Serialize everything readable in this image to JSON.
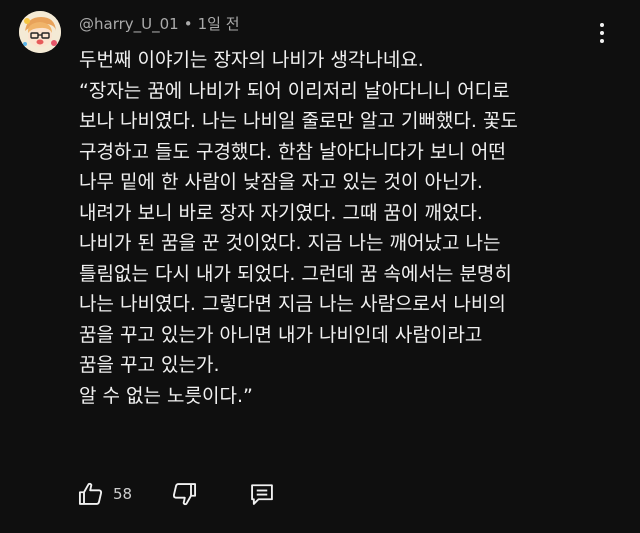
{
  "comment": {
    "author": "@harry_U_01",
    "separator": "•",
    "time": "1일 전",
    "lines": [
      "두번째 이야기는 장자의 나비가 생각나네요.",
      "“장자는 꿈에 나비가 되어 이리저리 날아다니니 어디로",
      "보나 나비였다. 나는 나비일 줄로만 알고 기뻐했다. 꽃도",
      "구경하고 들도 구경했다. 한참 날아다니다가 보니 어떤",
      "나무 밑에 한 사람이 낮잠을 자고 있는 것이 아닌가.",
      "내려가 보니 바로 장자 자기였다. 그때 꿈이 깨었다.",
      "나비가 된 꿈을 꾼 것이었다. 지금 나는 깨어났고 나는",
      "틀림없는 다시 내가 되었다. 그런데 꿈 속에서는 분명히",
      "나는 나비였다. 그렇다면 지금 나는 사람으로서 나비의",
      "꿈을 꾸고 있는가 아니면 내가 나비인데 사람이라고",
      "꿈을 꾸고 있는가.",
      "알 수 없는 노릇이다.”"
    ],
    "like_count": "58"
  },
  "icons": {
    "avatar": "avatar-image",
    "more": "more-vertical-icon",
    "like": "thumb-up-icon",
    "dislike": "thumb-down-icon",
    "reply": "reply-comment-icon"
  },
  "colors": {
    "background": "#0f0f0f",
    "text": "#f1f1f1",
    "meta": "#aaaaaa"
  }
}
